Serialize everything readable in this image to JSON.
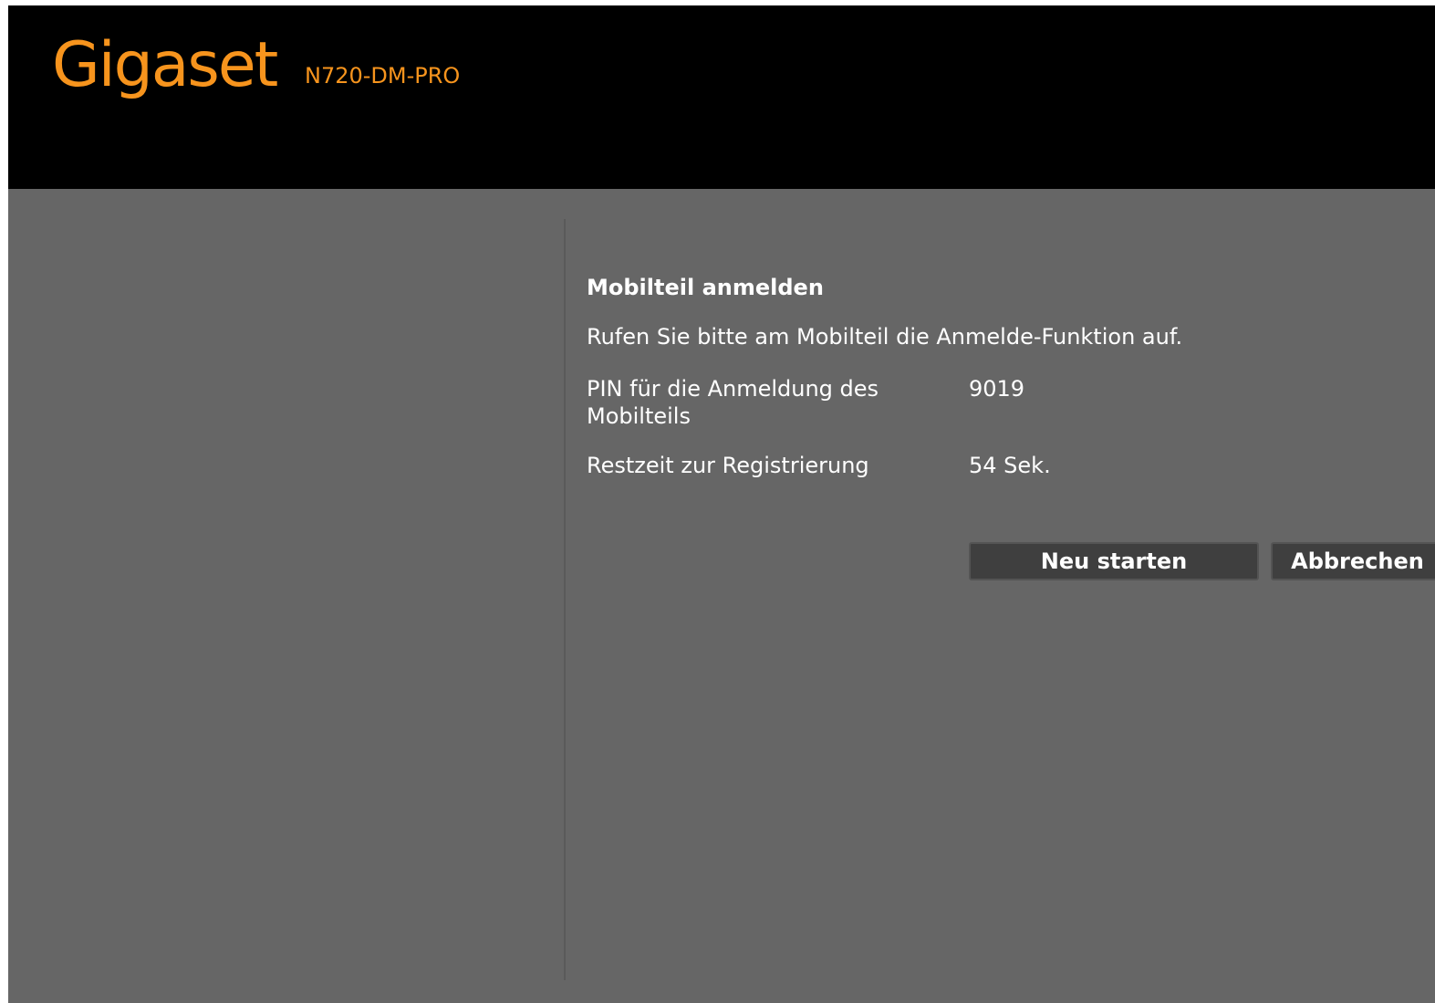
{
  "header": {
    "logo_text": "Gigaset",
    "model": "N720-DM-PRO",
    "brand_color": "#f7941d"
  },
  "registration": {
    "title": "Mobilteil anmelden",
    "instruction": "Rufen Sie bitte am Mobilteil die Anmelde-Funktion auf.",
    "pin_label": "PIN für die Anmeldung des Mobilteils",
    "pin_value": "9019",
    "time_label": "Restzeit zur Registrierung",
    "time_value": "54 Sek."
  },
  "buttons": {
    "restart_label": "Neu starten",
    "cancel_label": "Abbrechen"
  },
  "colors": {
    "header_bg": "#000000",
    "page_bg": "#666666",
    "button_bg": "#3f3f3f"
  }
}
